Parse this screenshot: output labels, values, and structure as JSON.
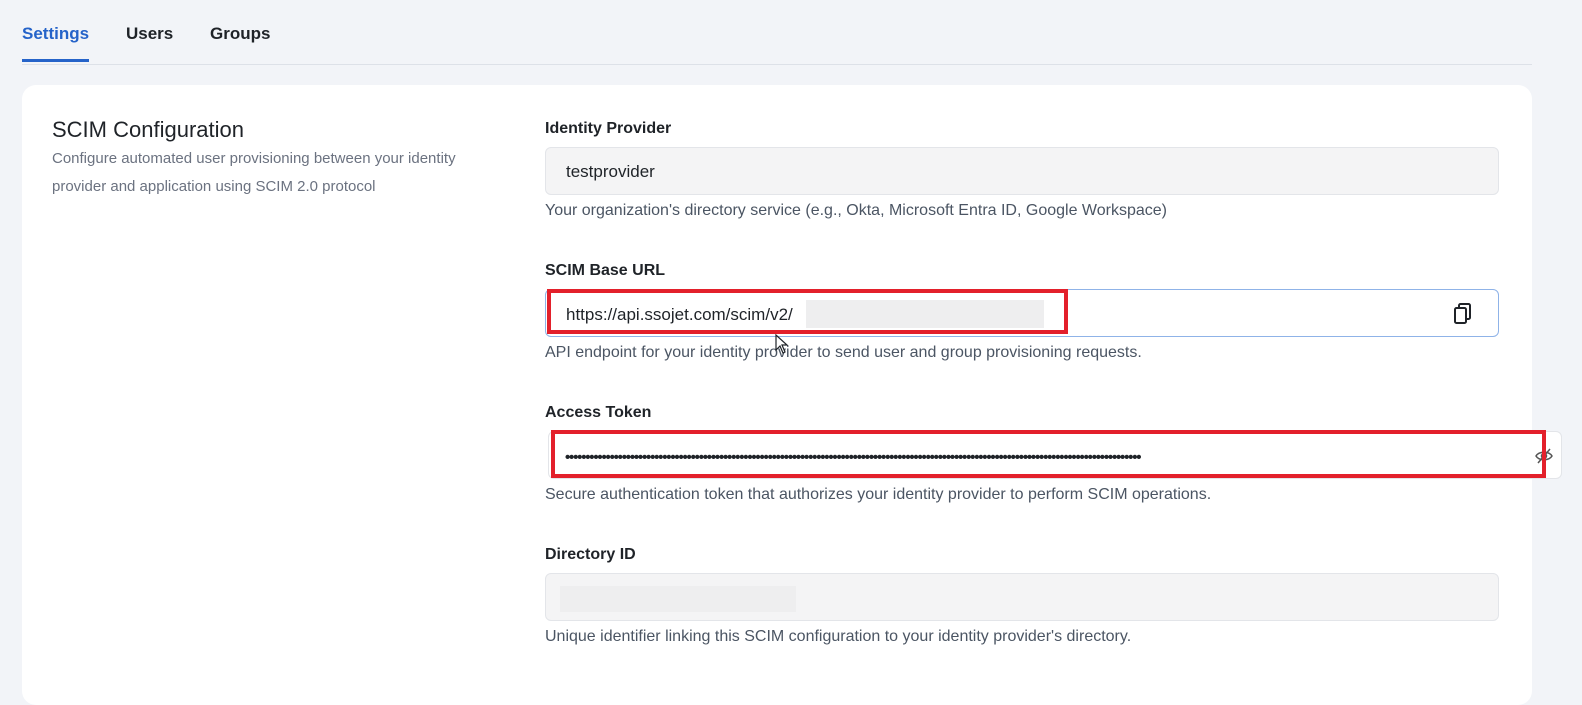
{
  "tabs": [
    {
      "label": "Settings",
      "active": true
    },
    {
      "label": "Users",
      "active": false
    },
    {
      "label": "Groups",
      "active": false
    }
  ],
  "section": {
    "title": "SCIM Configuration",
    "description": "Configure automated user provisioning between your identity provider and application using SCIM 2.0 protocol"
  },
  "fields": {
    "identity_provider": {
      "label": "Identity Provider",
      "value": "testprovider",
      "helper": "Your organization's directory service (e.g., Okta, Microsoft Entra ID, Google Workspace)"
    },
    "base_url": {
      "label": "SCIM Base URL",
      "value": "https://api.ssojet.com/scim/v2/",
      "helper": "API endpoint for your identity provider to send user and group provisioning requests.",
      "action_icon": "copy-icon"
    },
    "access_token": {
      "label": "Access Token",
      "masked_value": "••••••••••••••••••••••••••••••••••••••••••••••••••••••••••••••••••••••••••••••••••••••••••••••••••••••••••••••••••••••••••••••••••••••••••••••",
      "helper": "Secure authentication token that authorizes your identity provider to perform SCIM operations.",
      "action_icon": "eye-off-icon"
    },
    "directory_id": {
      "label": "Directory ID",
      "helper": "Unique identifier linking this SCIM configuration to your identity provider's directory."
    }
  },
  "colors": {
    "accent": "#2563c9",
    "highlight": "#e3202b",
    "background": "#f2f4f8",
    "card": "#ffffff"
  }
}
